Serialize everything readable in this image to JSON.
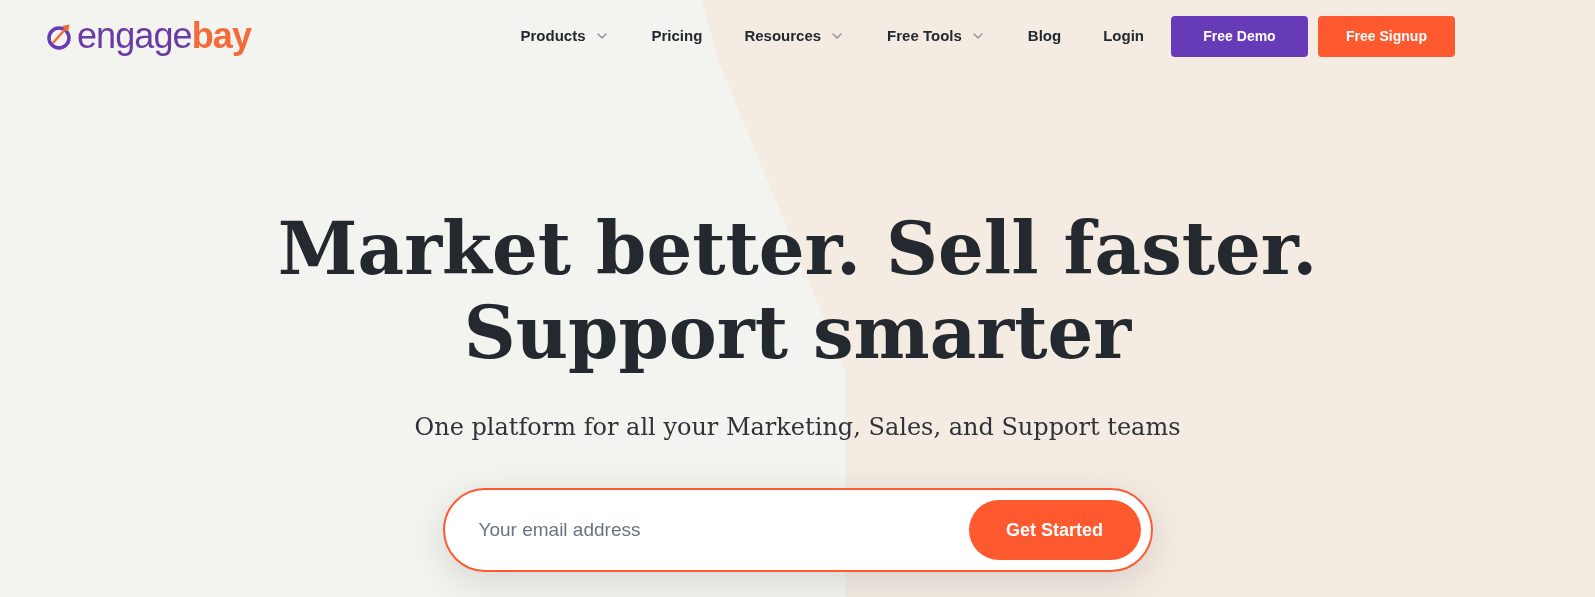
{
  "logo": {
    "text_1": "engage",
    "text_2": "bay"
  },
  "nav": [
    {
      "label": "Products",
      "has_dropdown": true
    },
    {
      "label": "Pricing",
      "has_dropdown": false
    },
    {
      "label": "Resources",
      "has_dropdown": true
    },
    {
      "label": "Free Tools",
      "has_dropdown": true
    },
    {
      "label": "Blog",
      "has_dropdown": false
    },
    {
      "label": "Login",
      "has_dropdown": false
    }
  ],
  "buttons": [
    {
      "label": "Free Demo",
      "kind": "purple"
    },
    {
      "label": "Free Signup",
      "kind": "orange"
    }
  ],
  "hero": {
    "headline": [
      "Market better. Sell faster.",
      "Support smarter"
    ],
    "subtitle": "One platform for all your Marketing, Sales, and Support teams"
  },
  "signup": {
    "placeholder": "Your email address",
    "button": "Get Started"
  }
}
